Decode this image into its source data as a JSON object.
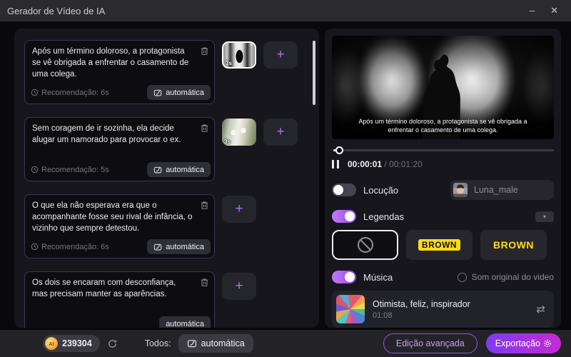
{
  "window": {
    "title": "Gerador de Vídeo de IA"
  },
  "icons": {
    "minimize": "–",
    "close": "✕",
    "close_small": "✕",
    "plus": "+",
    "caret_down": "▾",
    "swap": "⇄"
  },
  "scenes": [
    {
      "text": "Após um término doloroso, a protagonista se vê obrigada a enfrentar o casamento de uma colega.",
      "recommendation": "Recomendação: 6s",
      "auto_label": "automática",
      "thumb_duration": "3s"
    },
    {
      "text": "Sem coragem de ir sozinha, ela decide alugar um namorado para provocar o ex.",
      "recommendation": "Recomendação: 5s",
      "auto_label": "automática",
      "thumb_duration": "3s"
    },
    {
      "text": "O que ela não esperava era que o acompanhante fosse seu rival de infância, o vizinho que sempre detestou.",
      "recommendation": "Recomendação: 6s",
      "auto_label": "automática"
    },
    {
      "text": "Os dois se encaram com desconfiança, mas precisam manter as aparências.",
      "auto_label": "automática"
    }
  ],
  "preview": {
    "subtitle": "Após um término doloroso, a protagonista se vê obrigada a enfrentar o casamento de uma colega.",
    "current_time": "00:00:01",
    "time_separator": "/",
    "total_time": "00:01:20"
  },
  "voiceover": {
    "label": "Locução",
    "enabled": false,
    "voice_name": "Luna_male"
  },
  "captions": {
    "label": "Legendas",
    "enabled": true,
    "styles": [
      {
        "name": "none"
      },
      {
        "name": "brown-badge",
        "label": "BROWN"
      },
      {
        "name": "brown-text",
        "label": "BROWN"
      }
    ]
  },
  "music": {
    "label": "Música",
    "enabled": true,
    "original_sound_label": "Som original do video",
    "track_title": "Otimista, feliz, inspirador",
    "track_duration": "01:08"
  },
  "footer": {
    "coin_text": "AI",
    "credits": "239304",
    "all_label": "Todos:",
    "auto_label": "automática",
    "advanced_button": "Edição avançada",
    "export_button": "Exportação"
  },
  "colors": {
    "accent_purple": "#a855f7",
    "caption_yellow": "#ffdc17",
    "coin_gold": "#f5b43c",
    "export_gradient": [
      "#7e3bf0",
      "#c42ad4"
    ]
  }
}
